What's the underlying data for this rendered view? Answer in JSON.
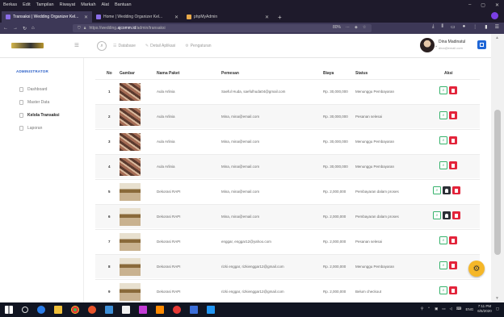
{
  "browser": {
    "menu": [
      "Berkas",
      "Edit",
      "Tampilan",
      "Riwayat",
      "Markah",
      "Alat",
      "Bantuan"
    ],
    "tabs": [
      {
        "title": "Transaksi | Wedding Organizer Kel...",
        "active": true
      },
      {
        "title": "Home | Wedding Organizer Kel...",
        "active": false
      },
      {
        "title": "phpMyAdmin",
        "active": false
      }
    ],
    "url_prefix": "https://wedding.",
    "url_domain": "ajcomm.id",
    "url_path": "/admin/transaksi",
    "zoom": "80%",
    "window_controls": [
      "–",
      "▢",
      "✕"
    ]
  },
  "header": {
    "logo_text": "WEDDING",
    "nav": [
      {
        "label": "Database",
        "icon": "database-icon"
      },
      {
        "label": "Detail Aplikasi",
        "icon": "edit-icon"
      },
      {
        "label": "Pengaturan",
        "icon": "gear-icon"
      }
    ],
    "user_name": "Dina Madinatul",
    "user_email": "dina@email.com"
  },
  "sidebar": {
    "category": "ADMINISTRATOR",
    "items": [
      {
        "label": "Dashboard",
        "active": false
      },
      {
        "label": "Master Data",
        "active": false
      },
      {
        "label": "Kelola Transaksi",
        "active": true
      },
      {
        "label": "Laporan",
        "active": false
      }
    ]
  },
  "table": {
    "columns": [
      "No",
      "Gambar",
      "Nama Paket",
      "Pemesan",
      "Biaya",
      "Status",
      "Aksi"
    ],
    "rows": [
      {
        "no": "1",
        "img": "aula",
        "paket": "Aula Arlinia",
        "pemesan": "Saeful Huda, saefulhuda04@gmail.com",
        "biaya": "Rp. 30,000,000",
        "status": "Menunggu Pembayaran",
        "extra_btn": false
      },
      {
        "no": "2",
        "img": "aula",
        "paket": "Aula Arlinia",
        "pemesan": "Mina, mina@email.com",
        "biaya": "Rp. 30,000,000",
        "status": "Pesanan selesai",
        "extra_btn": false
      },
      {
        "no": "3",
        "img": "aula",
        "paket": "Aula Arlinia",
        "pemesan": "Mina, mina@email.com",
        "biaya": "Rp. 30,000,000",
        "status": "Menunggu Pembayaran",
        "extra_btn": false
      },
      {
        "no": "4",
        "img": "aula",
        "paket": "Aula Arlinia",
        "pemesan": "Mina, mina@email.com",
        "biaya": "Rp. 30,000,000",
        "status": "Menunggu Pembayaran",
        "extra_btn": false
      },
      {
        "no": "5",
        "img": "deko",
        "paket": "Dekorasi RAPI",
        "pemesan": "Mina, mina@email.com",
        "biaya": "Rp. 2,000,000",
        "status": "Pembayaran dalam proses",
        "extra_btn": true
      },
      {
        "no": "6",
        "img": "deko",
        "paket": "Dekorasi RAPI",
        "pemesan": "Mina, mina@email.com",
        "biaya": "Rp. 2,000,000",
        "status": "Pembayaran dalam proses",
        "extra_btn": true
      },
      {
        "no": "7",
        "img": "deko",
        "paket": "Dekorasi RAPI",
        "pemesan": "enggar, enggar12@yahoo.com",
        "biaya": "Rp. 2,000,000",
        "status": "Pesanan selesai",
        "extra_btn": false
      },
      {
        "no": "8",
        "img": "deko",
        "paket": "Dekorasi RAPI",
        "pemesan": "rizki enggar, rizkienggar12@gmail.com",
        "biaya": "Rp. 2,000,000",
        "status": "Menunggu Pembayaran",
        "extra_btn": false
      },
      {
        "no": "9",
        "img": "deko",
        "paket": "Dekorasi RAPI",
        "pemesan": "rizki enggar, rizkienggar12@gmail.com",
        "biaya": "Rp. 2,000,000",
        "status": "Belum checkout",
        "extra_btn": false
      }
    ]
  },
  "taskbar": {
    "time": "7:11 PM",
    "date": "6/5/2020",
    "lang": "ENG"
  }
}
